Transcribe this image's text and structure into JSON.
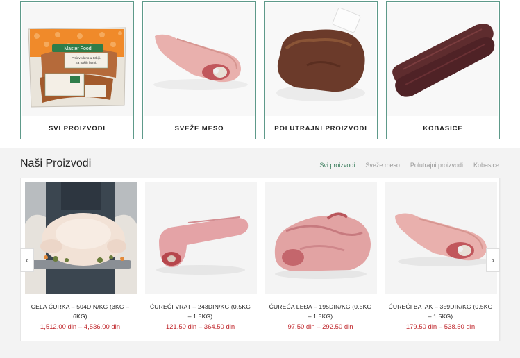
{
  "categories": [
    {
      "label": "SVI PROIZVODI"
    },
    {
      "label": "SVEŽE MESO"
    },
    {
      "label": "POLUTRAJNI PROIZVODI"
    },
    {
      "label": "KOBASICE"
    }
  ],
  "category_image_text": {
    "brand": "Master Food",
    "pkg_line1": "Proizvedeno u Srbiji.",
    "pkg_line2": "Sa naših farmi."
  },
  "section": {
    "title": "Naši Proizvodi",
    "tabs": [
      "Svi proizvodi",
      "Sveže meso",
      "Polutrajni proizvodi",
      "Kobasice"
    ]
  },
  "products": [
    {
      "name": "CELA ĆURKA – 504DIN/KG (3KG – 6KG)",
      "price": "1,512.00 din – 4,536.00 din"
    },
    {
      "name": "ĆUREĆI VRAT – 243DIN/KG (0.5KG – 1.5KG)",
      "price": "121.50 din – 364.50 din"
    },
    {
      "name": "ĆUREĆA LEĐA – 195DIN/KG (0.5KG – 1.5KG)",
      "price": "97.50 din – 292.50 din"
    },
    {
      "name": "ĆUREĆI BATAK – 359DIN/KG (0.5KG – 1.5KG)",
      "price": "179.50 din – 538.50 din"
    }
  ],
  "carousel": {
    "prev_icon": "chevron-left-icon",
    "next_icon": "chevron-right-icon",
    "prev_glyph": "‹",
    "next_glyph": "›"
  },
  "colors": {
    "accent_green": "#3a7d5c",
    "price_red": "#c0282d",
    "card_border": "#5e9a8a"
  }
}
